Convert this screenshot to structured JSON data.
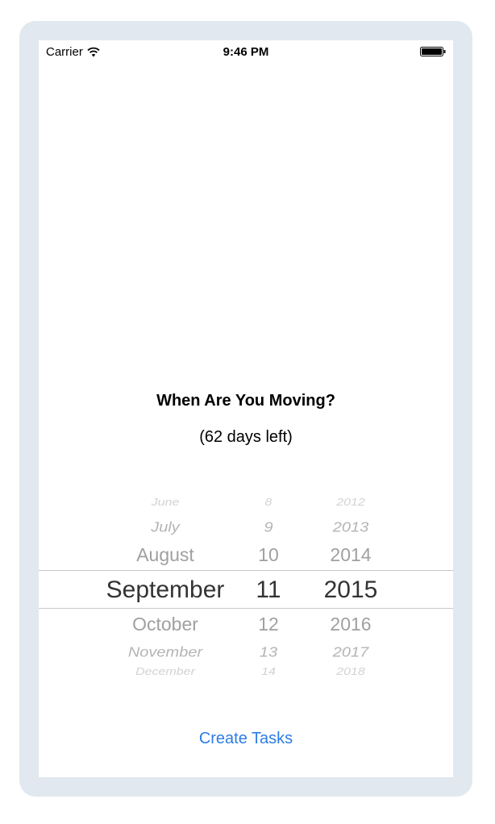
{
  "status_bar": {
    "carrier": "Carrier",
    "time": "9:46 PM",
    "icons": [
      "wifi-icon",
      "battery-icon"
    ]
  },
  "title": "When Are You Moving?",
  "subtitle": "(62 days left)",
  "picker": {
    "selected": {
      "month": "September",
      "day": "11",
      "year": "2015"
    },
    "months": [
      "June",
      "July",
      "August",
      "September",
      "October",
      "November",
      "December"
    ],
    "days": [
      "8",
      "9",
      "10",
      "11",
      "12",
      "13",
      "14"
    ],
    "years": [
      "2012",
      "2013",
      "2014",
      "2015",
      "2016",
      "2017",
      "2018"
    ]
  },
  "create_button": "Create Tasks",
  "colors": {
    "frame": "#e1e8f0",
    "accent": "#2d7ce6",
    "selected_text": "#333333",
    "dim_text": "#a0a0a0"
  }
}
